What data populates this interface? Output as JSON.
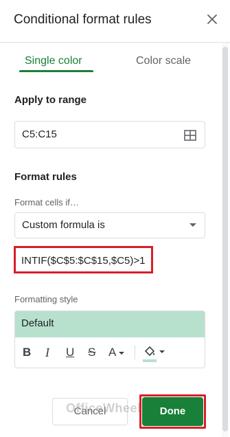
{
  "header": {
    "title": "Conditional format rules",
    "close_icon": "close-icon"
  },
  "tabs": [
    {
      "label": "Single color",
      "active": true
    },
    {
      "label": "Color scale",
      "active": false
    }
  ],
  "apply_range": {
    "label": "Apply to range",
    "value": "C5:C15",
    "icon": "grid-select-icon"
  },
  "format_rules": {
    "label": "Format rules",
    "condition_label": "Format cells if…",
    "condition_value": "Custom formula is",
    "formula_value": "INTIF($C$5:$C$15,$C5)>1"
  },
  "formatting_style": {
    "label": "Formatting style",
    "preview_text": "Default",
    "preview_color": "#b7e1cd",
    "toolbar": {
      "bold": "B",
      "italic": "I",
      "underline": "U",
      "strikethrough": "S",
      "text_color": "A"
    }
  },
  "actions": {
    "cancel_label": "Cancel",
    "done_label": "Done"
  },
  "watermark": "OfficeWheel",
  "colors": {
    "accent": "#188038",
    "highlight": "#d61f28"
  }
}
